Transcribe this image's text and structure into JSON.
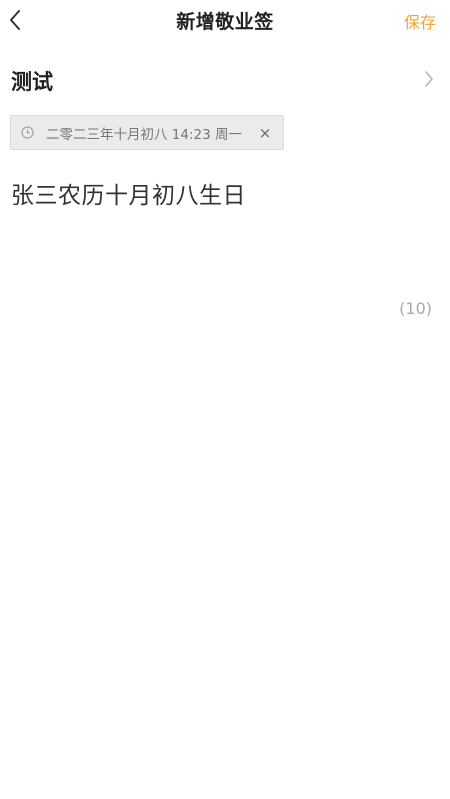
{
  "header": {
    "title": "新增敬业签",
    "save_label": "保存",
    "back_icon": "chevron-left-icon"
  },
  "category": {
    "label": "测试",
    "chevron_icon": "chevron-right-icon"
  },
  "reminder": {
    "clock_icon": "clock-icon",
    "text": "二零二三年十月初八 14:23 周一",
    "remove_label": "×"
  },
  "note": {
    "content": "张三农历十月初八生日",
    "char_count": "(10)"
  },
  "colors": {
    "accent": "#f0a630",
    "chip_background": "#ebebeb",
    "muted_text": "#a8a8a8"
  }
}
